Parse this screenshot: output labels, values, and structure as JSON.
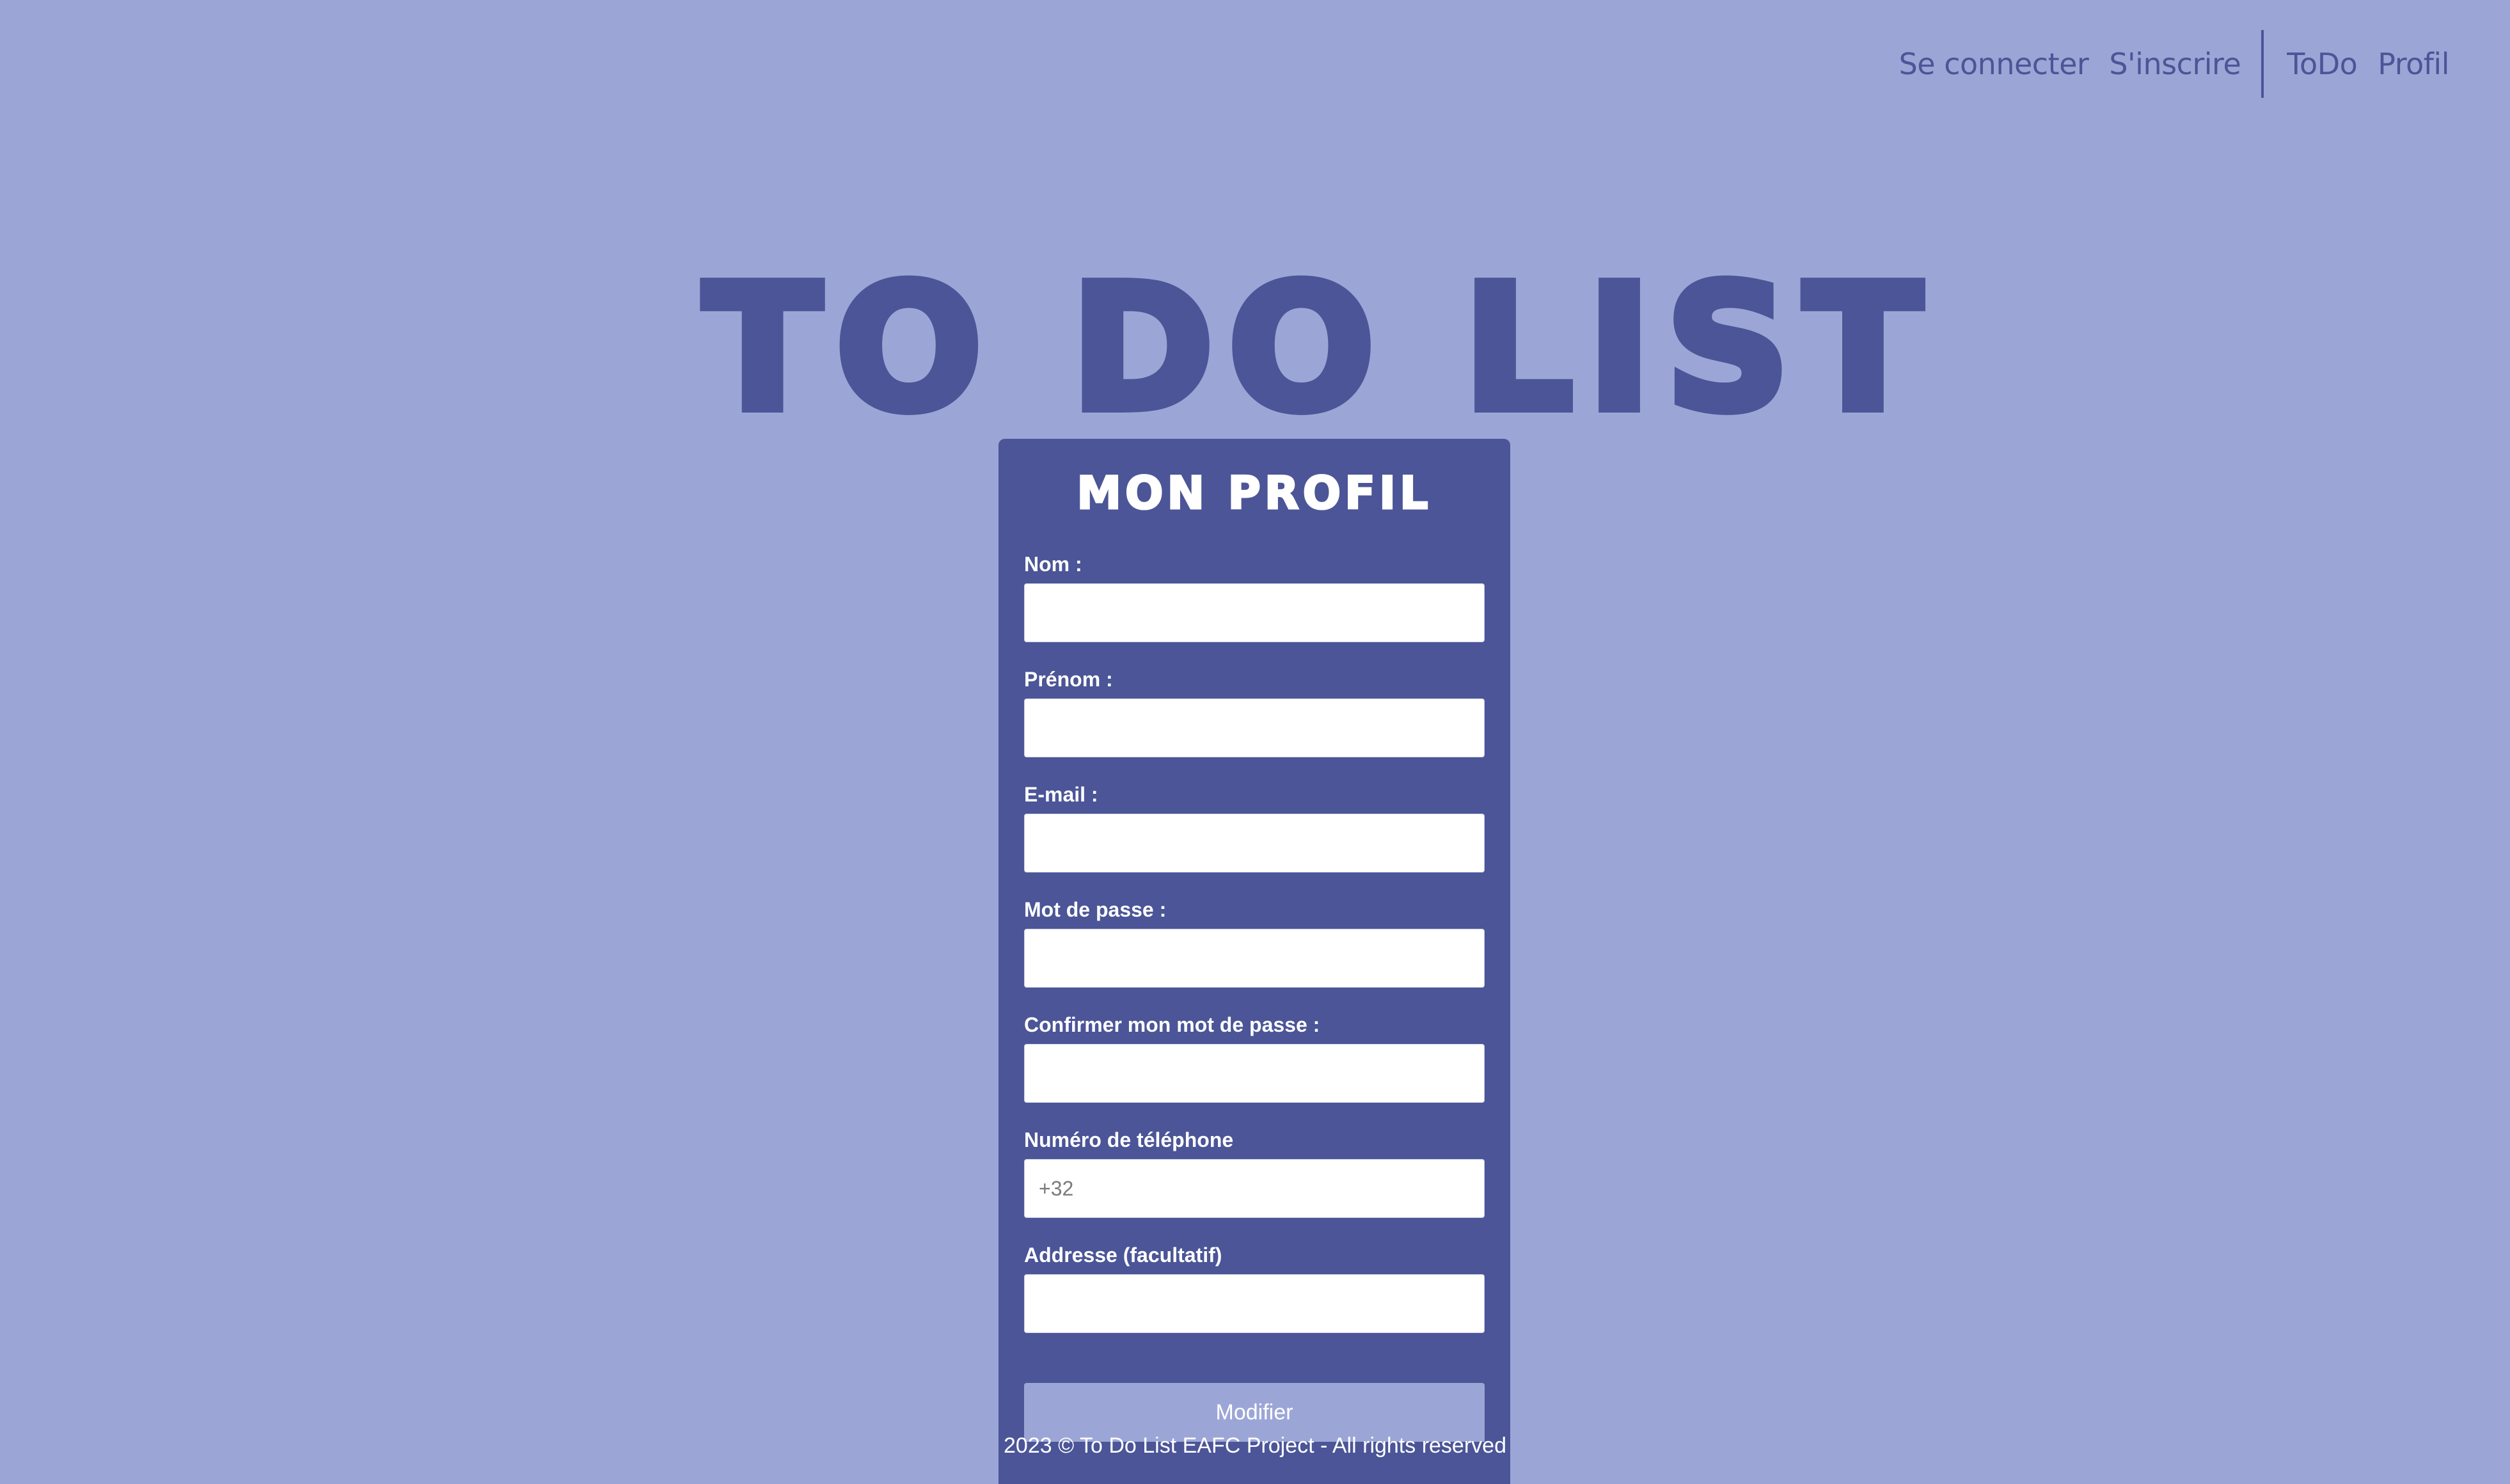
{
  "nav": {
    "login": "Se connecter",
    "register": "S'inscrire",
    "todo": "ToDo",
    "profile": "Profil"
  },
  "site_title": "To Do List",
  "card": {
    "title": "Mon Profil",
    "fields": [
      {
        "label": "Nom :",
        "value": "",
        "placeholder": ""
      },
      {
        "label": "Prénom :",
        "value": "",
        "placeholder": ""
      },
      {
        "label": "E-mail :",
        "value": "",
        "placeholder": ""
      },
      {
        "label": "Mot de passe :",
        "value": "",
        "placeholder": ""
      },
      {
        "label": "Confirmer mon mot de passe :",
        "value": "",
        "placeholder": ""
      },
      {
        "label": "Numéro de téléphone",
        "value": "",
        "placeholder": "+32"
      },
      {
        "label": "Addresse (facultatif)",
        "value": "",
        "placeholder": ""
      }
    ],
    "submit_label": "Modifier"
  },
  "footer": {
    "text": "2023 © To Do List EAFC Project - All rights reserved"
  },
  "colors": {
    "background": "#9ca6d6",
    "accent": "#4b5597",
    "text_light": "#ffffff"
  }
}
